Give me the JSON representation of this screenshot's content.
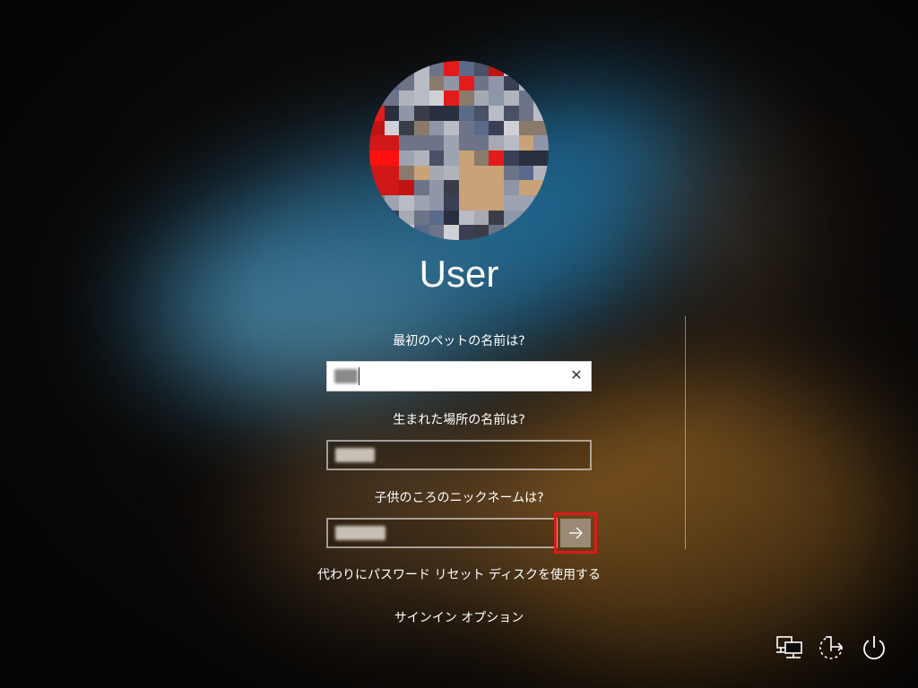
{
  "user": {
    "name": "User"
  },
  "questions": [
    {
      "label": "最初のペットの名前は?"
    },
    {
      "label": "生まれた場所の名前は?"
    },
    {
      "label": "子供のころのニックネームは?"
    }
  ],
  "links": {
    "reset_disk": "代わりにパスワード リセット ディスクを使用する",
    "signin_options": "サインイン オプション"
  },
  "icons": {
    "clear": "close-icon",
    "submit": "arrow-right-icon",
    "network": "network-icon",
    "accessibility": "ease-of-access-icon",
    "power": "power-icon"
  },
  "colors": {
    "submit_highlight": "#e01818",
    "submit_bg": "#9a8a73"
  }
}
